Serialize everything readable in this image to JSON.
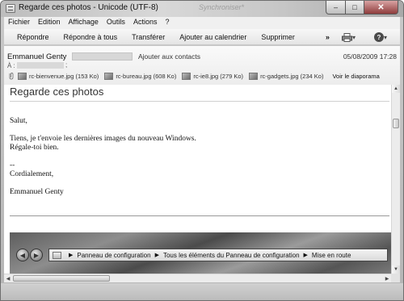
{
  "window": {
    "title": "Regarde ces photos - Unicode (UTF-8)",
    "background_title": "Synchroniser*",
    "min_glyph": "–",
    "max_glyph": "□",
    "close_glyph": "✕"
  },
  "menu": [
    "Fichier",
    "Edition",
    "Affichage",
    "Outils",
    "Actions",
    "?"
  ],
  "toolbar": {
    "buttons": [
      "Répondre",
      "Répondre à tous",
      "Transférer",
      "Ajouter au calendrier",
      "Supprimer"
    ],
    "more": "»",
    "print_glyph": "▾",
    "help": "?"
  },
  "header": {
    "sender": "Emmanuel Genty",
    "add_contact": "Ajouter aux contacts",
    "date": "05/08/2009 17:28",
    "to_label": "À :",
    "to_semicolon": ";",
    "attachments": [
      "rc-bienvenue.jpg (153 Ko)",
      "rc-bureau.jpg (608 Ko)",
      "rc-ie8.jpg (279 Ko)",
      "rc-gadgets.jpg (234 Ko)"
    ],
    "slideshow": "Voir le diaporama"
  },
  "message": {
    "subject": "Regarde ces photos",
    "lines": [
      "Salut,",
      "",
      "Tiens, je t'envoie les dernières images du nouveau Windows.",
      "Régale-toi bien.",
      "",
      "--",
      "Cordialement,",
      "",
      "Emmanuel Genty"
    ]
  },
  "embedded": {
    "back": "◀",
    "forward": "▶",
    "breadcrumbs": [
      "Panneau de configuration",
      "Tous les éléments du Panneau de configuration",
      "Mise en route"
    ],
    "separator": "▶"
  },
  "scroll": {
    "up": "▲",
    "down": "▼",
    "left": "◀",
    "right": "▶",
    "grip": "⁞⁞"
  }
}
